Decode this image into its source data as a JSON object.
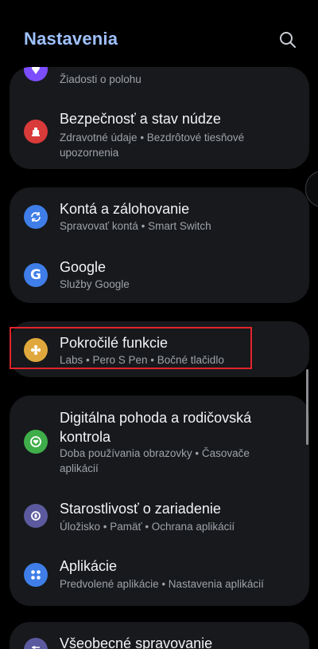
{
  "header": {
    "title": "Nastavenia",
    "search_icon": "search-icon"
  },
  "cards": [
    {
      "items": [
        {
          "icon": "location-icon",
          "icon_color": "#7c4dff",
          "title": "",
          "subtitle": "Žiadosti o polohu"
        },
        {
          "icon": "emergency-icon",
          "icon_color": "#d93a3a",
          "title": "Bezpečnosť a stav núdze",
          "subtitle_lines": [
            "Zdravotné údaje  •  Bezdrôtové tiesňové",
            "upozornenia"
          ]
        }
      ]
    },
    {
      "items": [
        {
          "icon": "sync-icon",
          "icon_color": "#3f7ee8",
          "title": "Kontá a zálohovanie",
          "subtitle": "Spravovať kontá  •  Smart Switch"
        },
        {
          "icon": "google-icon",
          "icon_color": "#3f7ee8",
          "title": "Google",
          "subtitle": "Služby Google"
        }
      ]
    },
    {
      "items": [
        {
          "icon": "advanced-features-icon",
          "icon_color": "#e0a83c",
          "title": "Pokročilé funkcie",
          "subtitle": "Labs  •  Pero S Pen  •  Bočné tlačidlo"
        }
      ]
    },
    {
      "items": [
        {
          "icon": "digital-wellbeing-icon",
          "icon_color": "#3fae4a",
          "title_lines": [
            "Digitálna pohoda a rodičovská",
            "kontrola"
          ],
          "subtitle_lines": [
            "Doba používania obrazovky  •  Časovače",
            "aplikácií"
          ]
        },
        {
          "icon": "device-care-icon",
          "icon_color": "#5c5a9e",
          "title": "Starostlivosť o zariadenie",
          "subtitle": "Úložisko  •  Pamäť  •  Ochrana aplikácií"
        },
        {
          "icon": "apps-icon",
          "icon_color": "#3f7ee8",
          "title": "Aplikácie",
          "subtitle": "Predvolené aplikácie  •  Nastavenia aplikácií"
        }
      ]
    },
    {
      "items": [
        {
          "icon": "general-management-icon",
          "icon_color": "#5c5a9e",
          "title": "Všeobecné spravovanie",
          "subtitle": ""
        }
      ]
    }
  ]
}
